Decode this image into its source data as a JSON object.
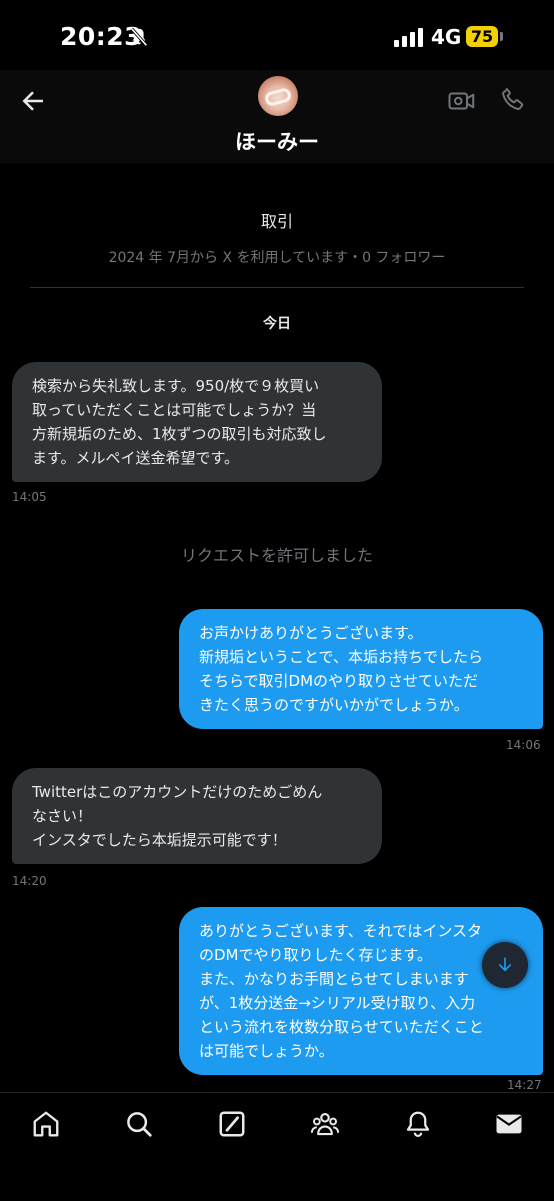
{
  "status": {
    "time": "20:23",
    "network": "4G",
    "battery": "75"
  },
  "header": {
    "name": "ほーみー"
  },
  "conversation": {
    "title": "取引",
    "meta": "2024 年 7月から X を利用しています・0 フォロワー",
    "day_label": "今日"
  },
  "messages": [
    {
      "direction": "in",
      "lines": [
        "検索から失礼致します。950/枚で９枚買い",
        "取っていただくことは可能でしょうか？当",
        "方新規垢のため、1枚ずつの取引も対応致し",
        "ます。メルペイ送金希望です。"
      ],
      "time": "14:05"
    },
    {
      "direction": "out",
      "lines": [
        "お声かけありがとうございます。",
        "新規垢ということで、本垢お持ちでしたら",
        "そちらで取引DMのやり取りさせていただ",
        "きたく思うのですがいかがでしょうか。"
      ],
      "time": "14:06"
    },
    {
      "direction": "in",
      "lines": [
        "Twitterはこのアカウントだけのためごめん",
        "なさい！",
        "インスタでしたら本垢提示可能です！"
      ],
      "time": "14:20"
    },
    {
      "direction": "out",
      "lines": [
        "ありがとうございます、それではインスタ",
        "のDMでやり取りしたく存じます。",
        "また、かなりお手間とらせてしまいます",
        "が、1枚分送金→シリアル受け取り、入力",
        "という流れを枚数分取らせていただくこと",
        "は可能でしょうか。"
      ],
      "time": "14:27"
    }
  ],
  "system_message": "リクエストを許可しました",
  "icons": {
    "back": "arrow-left-icon",
    "video": "video-camera-icon",
    "phone": "phone-icon",
    "scroll": "arrow-down-icon",
    "home": "home-icon",
    "search": "search-icon",
    "grok": "grok-icon",
    "communities": "people-icon",
    "notifications": "bell-icon",
    "messages": "envelope-icon"
  },
  "colors": {
    "accent": "#1d9bf0",
    "incoming_bubble": "#2f3336",
    "muted": "#71767b",
    "battery": "#f5d000"
  }
}
